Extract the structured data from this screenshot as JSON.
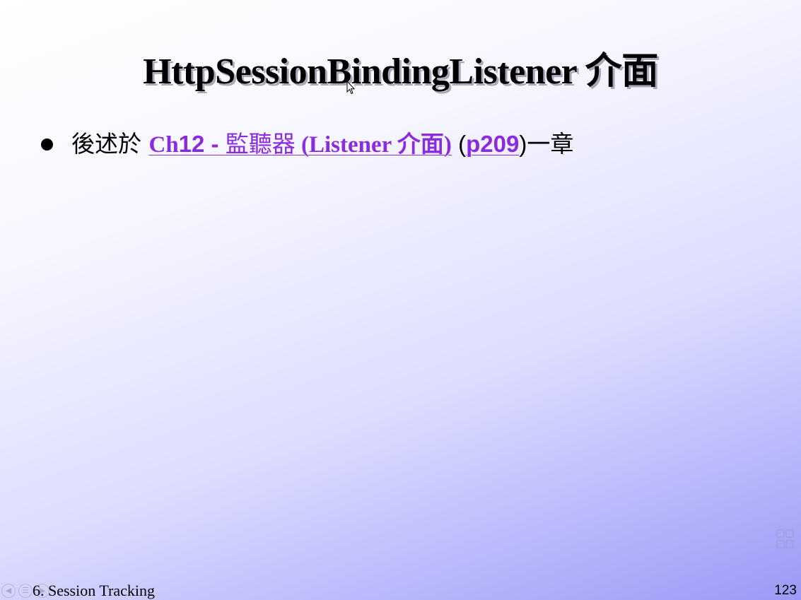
{
  "slide": {
    "title": "HttpSessionBindingListener 介面",
    "bullet": {
      "prefix": "後述於 ",
      "link": {
        "ch": "Ch",
        "num": "12 - ",
        "cjk": "監聽器",
        "rest": " (Listener 介面)"
      },
      "paren_open": " (",
      "page_link": "p209",
      "paren_close": ")",
      "suffix": "一章"
    },
    "footer": {
      "section": "6. Session Tracking",
      "page_number": "123"
    }
  },
  "colors": {
    "link": "#8b2be0",
    "background_end": "#9a9af6"
  },
  "icons": {
    "cursor": "mouse-pointer-icon",
    "nav": [
      "prev-slide-icon",
      "menu-icon",
      "next-slide-icon"
    ]
  }
}
